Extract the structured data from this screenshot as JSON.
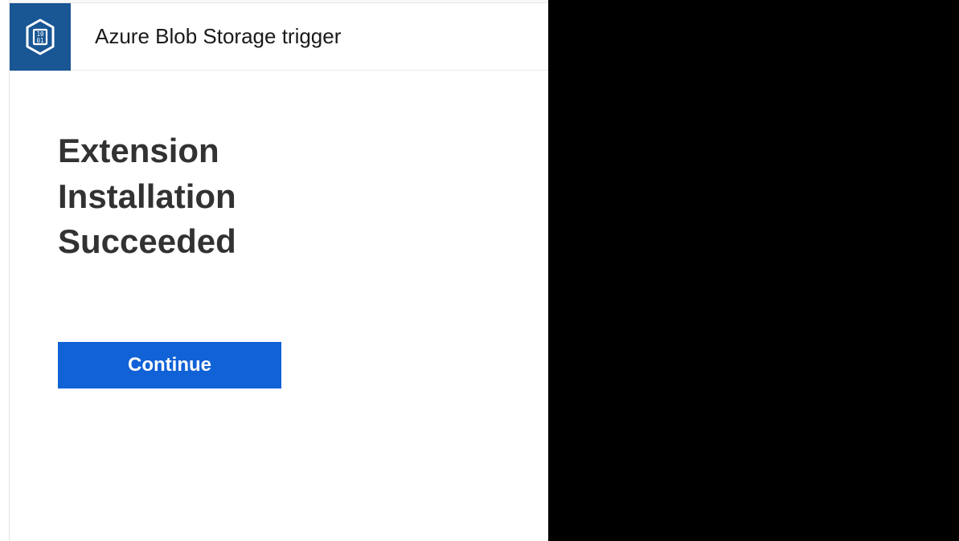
{
  "header": {
    "title": "Azure Blob Storage trigger",
    "icon_name": "blob-storage-icon"
  },
  "main": {
    "message": "Extension Installation Succeeded",
    "continue_label": "Continue"
  },
  "colors": {
    "icon_bg": "#185694",
    "button_bg": "#1062d6",
    "heading": "#323232"
  }
}
